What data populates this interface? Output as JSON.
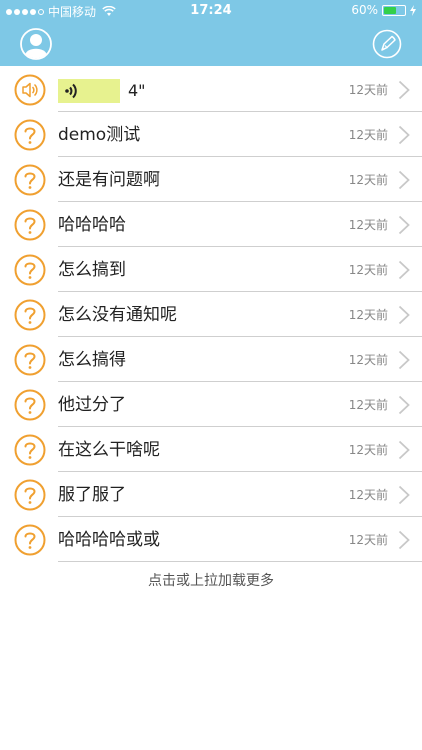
{
  "status_bar": {
    "carrier": "中国移动",
    "time": "17:24",
    "battery": "60%",
    "battery_level": 0.6,
    "signal_dots_filled": 4,
    "signal_dots_total": 5
  },
  "nav": {
    "left_icon": "avatar-icon",
    "right_icon": "edit-icon"
  },
  "voice_item": {
    "duration": "4\"",
    "time": "12天前"
  },
  "items": [
    {
      "title": "demo测试",
      "time": "12天前"
    },
    {
      "title": "还是有问题啊",
      "time": "12天前"
    },
    {
      "title": "哈哈哈哈",
      "time": "12天前"
    },
    {
      "title": "怎么搞到",
      "time": "12天前"
    },
    {
      "title": "怎么没有通知呢",
      "time": "12天前"
    },
    {
      "title": "怎么搞得",
      "time": "12天前"
    },
    {
      "title": "他过分了",
      "time": "12天前"
    },
    {
      "title": "在这么干啥呢",
      "time": "12天前"
    },
    {
      "title": "服了服了",
      "time": "12天前"
    },
    {
      "title": "哈哈哈哈或或",
      "time": "12天前"
    }
  ],
  "load_more": "点击或上拉加载更多",
  "colors": {
    "nav_background": "#7ec8e6",
    "icon_orange": "#f0a030",
    "voice_bubble": "#e7f28f",
    "battery_green": "#33d04a"
  }
}
